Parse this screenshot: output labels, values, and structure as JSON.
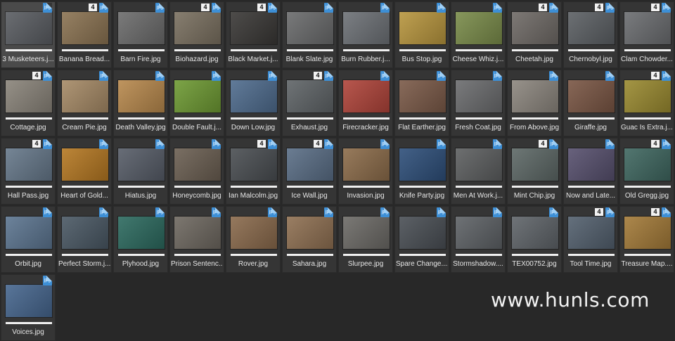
{
  "browser": {
    "items": [
      {
        "name": "3 Musketeers.j...",
        "color": "#5a5d62",
        "selected": true
      },
      {
        "name": "Banana Bread...",
        "color": "#8b7352",
        "rating": "4"
      },
      {
        "name": "Barn Fire.jpg",
        "color": "#6c6c6c"
      },
      {
        "name": "Biohazard.jpg",
        "color": "#7a7060",
        "rating": "4"
      },
      {
        "name": "Black Market.j...",
        "color": "#3a3836",
        "rating": "4"
      },
      {
        "name": "Blank Slate.jpg",
        "color": "#6a6b6c"
      },
      {
        "name": "Burn Rubber.j...",
        "color": "#6d7176"
      },
      {
        "name": "Bus Stop.jpg",
        "color": "#b8963e"
      },
      {
        "name": "Cheese Whiz.j...",
        "color": "#7a8c4a"
      },
      {
        "name": "Cheetah.jpg",
        "color": "#6f6a66",
        "rating": "4"
      },
      {
        "name": "Chernobyl.jpg",
        "color": "#5c6064",
        "rating": "4"
      },
      {
        "name": "Clam Chowder...",
        "color": "#6b6d70",
        "rating": "4"
      },
      {
        "name": "Cottage.jpg",
        "color": "#8a847a",
        "rating": "4"
      },
      {
        "name": "Cream Pie.jpg",
        "color": "#a68a66"
      },
      {
        "name": "Death Valley.jpg",
        "color": "#b8894d"
      },
      {
        "name": "Double Fault.j...",
        "color": "#6e9a33"
      },
      {
        "name": "Down Low.jpg",
        "color": "#4f6c8e"
      },
      {
        "name": "Exhaust.jpg",
        "color": "#5f6467",
        "rating": "4"
      },
      {
        "name": "Firecracker.jpg",
        "color": "#b0443a"
      },
      {
        "name": "Flat Earther.jpg",
        "color": "#7b5a48"
      },
      {
        "name": "Fresh Coat.jpg",
        "color": "#6b6c6e"
      },
      {
        "name": "From Above.jpg",
        "color": "#8c867e"
      },
      {
        "name": "Giraffe.jpg",
        "color": "#7a5644"
      },
      {
        "name": "Guac Is Extra.j...",
        "color": "#9a8a30",
        "rating": "4"
      },
      {
        "name": "Hall Pass.jpg",
        "color": "#66788a",
        "rating": "4"
      },
      {
        "name": "Heart of Gold...",
        "color": "#b57822"
      },
      {
        "name": "Hiatus.jpg",
        "color": "#575d68"
      },
      {
        "name": "Honeycomb.jpg",
        "color": "#6b5f52"
      },
      {
        "name": "Ian Malcolm.jpg",
        "color": "#4a4e52",
        "rating": "4"
      },
      {
        "name": "Ice Wall.jpg",
        "color": "#5a6e86",
        "rating": "4"
      },
      {
        "name": "Invasion.jpg",
        "color": "#8c6c4a"
      },
      {
        "name": "Knife Party.jpg",
        "color": "#2e4f7a"
      },
      {
        "name": "Men At Work.j...",
        "color": "#5d5f60"
      },
      {
        "name": "Mint Chip.jpg",
        "color": "#5d6866",
        "rating": "4"
      },
      {
        "name": "Now and Late...",
        "color": "#57506e"
      },
      {
        "name": "Old Gregg.jpg",
        "color": "#3f6760",
        "rating": "4"
      },
      {
        "name": "Orbit.jpg",
        "color": "#5c7590"
      },
      {
        "name": "Perfect Storm.j...",
        "color": "#4a5864"
      },
      {
        "name": "Plyhood.jpg",
        "color": "#2c6a5f"
      },
      {
        "name": "Prison Sentenc...",
        "color": "#6e6860"
      },
      {
        "name": "Rover.jpg",
        "color": "#8a6a4c"
      },
      {
        "name": "Sahara.jpg",
        "color": "#8f7052"
      },
      {
        "name": "Slurpee.jpg",
        "color": "#6c6a66"
      },
      {
        "name": "Spare Change....",
        "color": "#4a4f55"
      },
      {
        "name": "Stormshadow....",
        "color": "#5e6266"
      },
      {
        "name": "TEX00752.jpg",
        "color": "#5f6469"
      },
      {
        "name": "Tool Time.jpg",
        "color": "#53606e",
        "rating": "4"
      },
      {
        "name": "Treasure Map....",
        "color": "#a37a38",
        "rating": "4"
      },
      {
        "name": "Voices.jpg",
        "color": "#46668e"
      }
    ]
  },
  "badge_label": "jpg",
  "watermark": "www.hunls.com"
}
